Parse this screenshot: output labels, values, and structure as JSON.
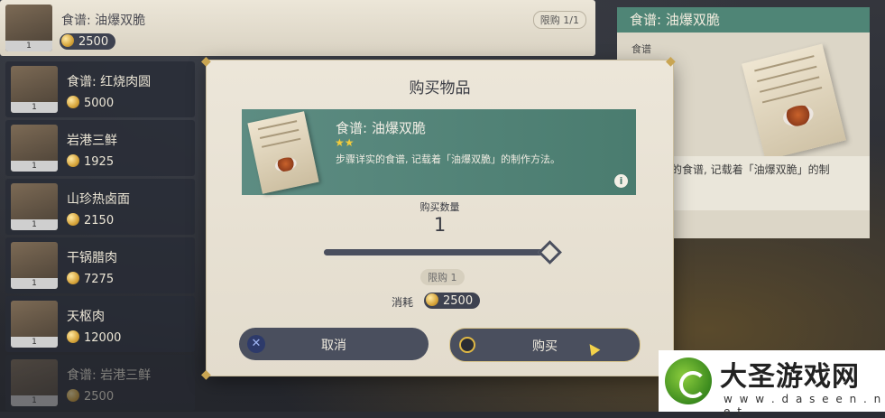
{
  "shop_list": [
    {
      "name": "食谱: 油爆双脆",
      "price": "2500",
      "qty": "1",
      "limit": "限购 1/1",
      "selected": true
    },
    {
      "name": "食谱: 红烧肉圆",
      "price": "5000",
      "qty": "1"
    },
    {
      "name": "岩港三鲜",
      "price": "1925",
      "qty": "1"
    },
    {
      "name": "山珍热卤面",
      "price": "2150",
      "qty": "1"
    },
    {
      "name": "干锅腊肉",
      "price": "7275",
      "qty": "1"
    },
    {
      "name": "天枢肉",
      "price": "12000",
      "qty": "1"
    },
    {
      "name": "食谱: 岩港三鲜",
      "price": "2500",
      "qty": "1",
      "dimmed": true
    }
  ],
  "detail": {
    "title": "食谱: 油爆双脆",
    "type": "食谱",
    "desc": "实的食谱, 记载着「油爆双脆」的制"
  },
  "dialog": {
    "title": "购买物品",
    "item_name": "食谱: 油爆双脆",
    "stars": "★★",
    "item_desc": "步骤详实的食谱, 记载着「油爆双脆」的制作方法。",
    "info_glyph": "i",
    "qty_label": "购买数量",
    "qty_value": "1",
    "slider_fraction": 1,
    "limit": "限购 1",
    "cost_label": "消耗",
    "cost_value": "2500",
    "cancel_label": "取消",
    "buy_label": "购买"
  },
  "watermark": {
    "title": "大圣游戏网",
    "url": "w w w . d a s e e n . n e t"
  },
  "colors": {
    "accent_teal": "#4f8576",
    "coin_gold": "#d6a43a",
    "button_dark": "#4a4f5e"
  },
  "icons": {
    "cancel": "x-icon",
    "buy": "circle-icon",
    "info": "info-icon",
    "cursor": "pointer-icon"
  }
}
